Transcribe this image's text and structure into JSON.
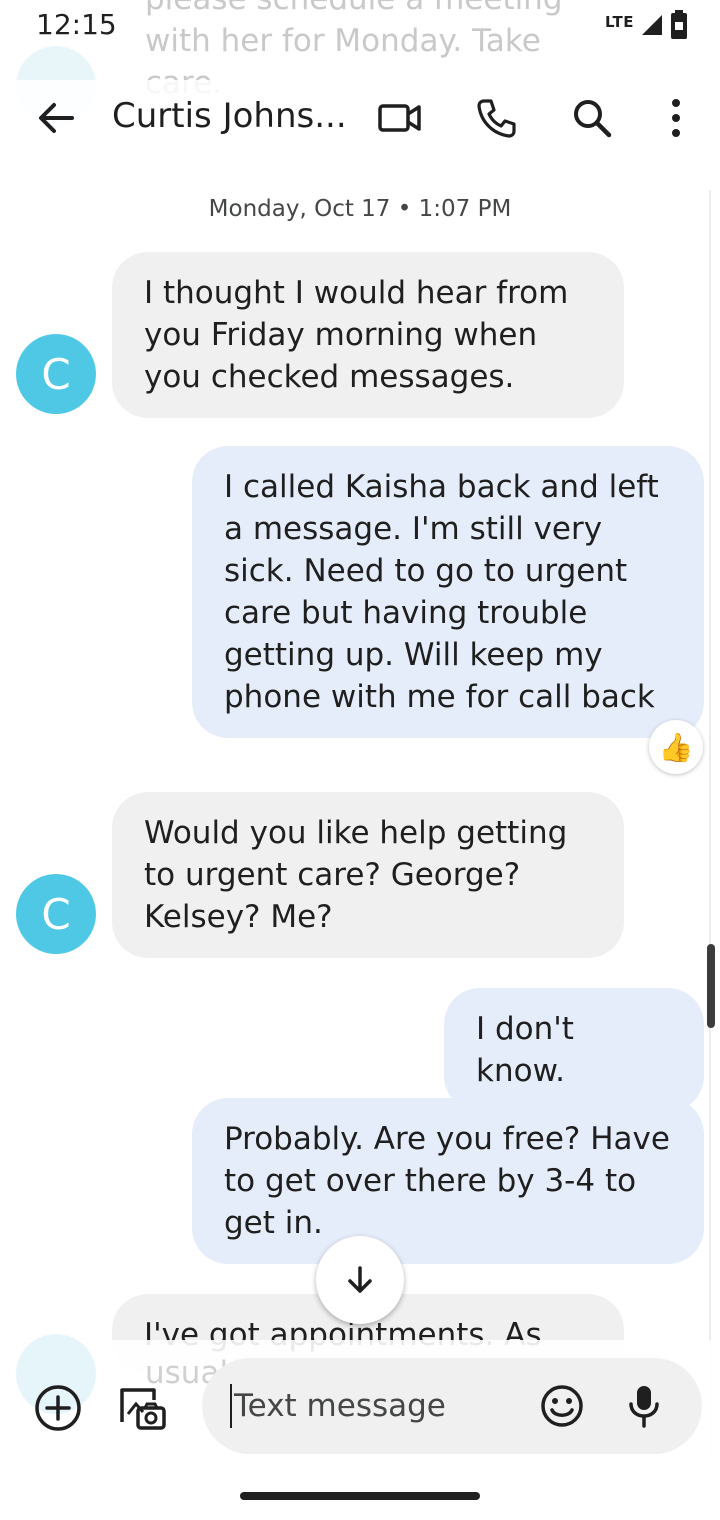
{
  "status_bar": {
    "time": "12:15",
    "network": "LTE"
  },
  "ghost": {
    "top_text": "please schedule a meeting with her for Monday.  Take care.",
    "avatar_letter": "C",
    "bottom_text": "usual"
  },
  "header": {
    "contact_name": "Curtis Johns...",
    "icons": [
      "back-arrow-icon",
      "video-call-icon",
      "phone-icon",
      "search-icon",
      "more-vert-icon"
    ]
  },
  "conversation": {
    "timestamp": "Monday, Oct 17 • 1:07 PM",
    "messages": [
      {
        "direction": "incoming",
        "avatar": "C",
        "text": "I thought I would hear from you Friday morning when you checked messages."
      },
      {
        "direction": "outgoing",
        "text": "I called Kaisha back and left a message. I'm still very sick. Need to go to urgent care but having trouble getting up. Will keep my phone with me for call back",
        "reaction": "👍"
      },
      {
        "direction": "incoming",
        "avatar": "C",
        "text": "Would you like help getting to urgent care?  George? Kelsey?  Me?"
      },
      {
        "direction": "outgoing",
        "text": "I don't know."
      },
      {
        "direction": "outgoing",
        "text": "Probably. Are you free? Have to get over there by 3-4 to get in."
      },
      {
        "direction": "incoming",
        "text": "I've got appointments. As"
      }
    ]
  },
  "compose": {
    "placeholder": "Text message"
  },
  "colors": {
    "avatar": "#4fc8e5",
    "incoming_bubble": "#f0f0f0",
    "outgoing_bubble": "#e6edfa",
    "compose_field": "#f0f0f0"
  }
}
